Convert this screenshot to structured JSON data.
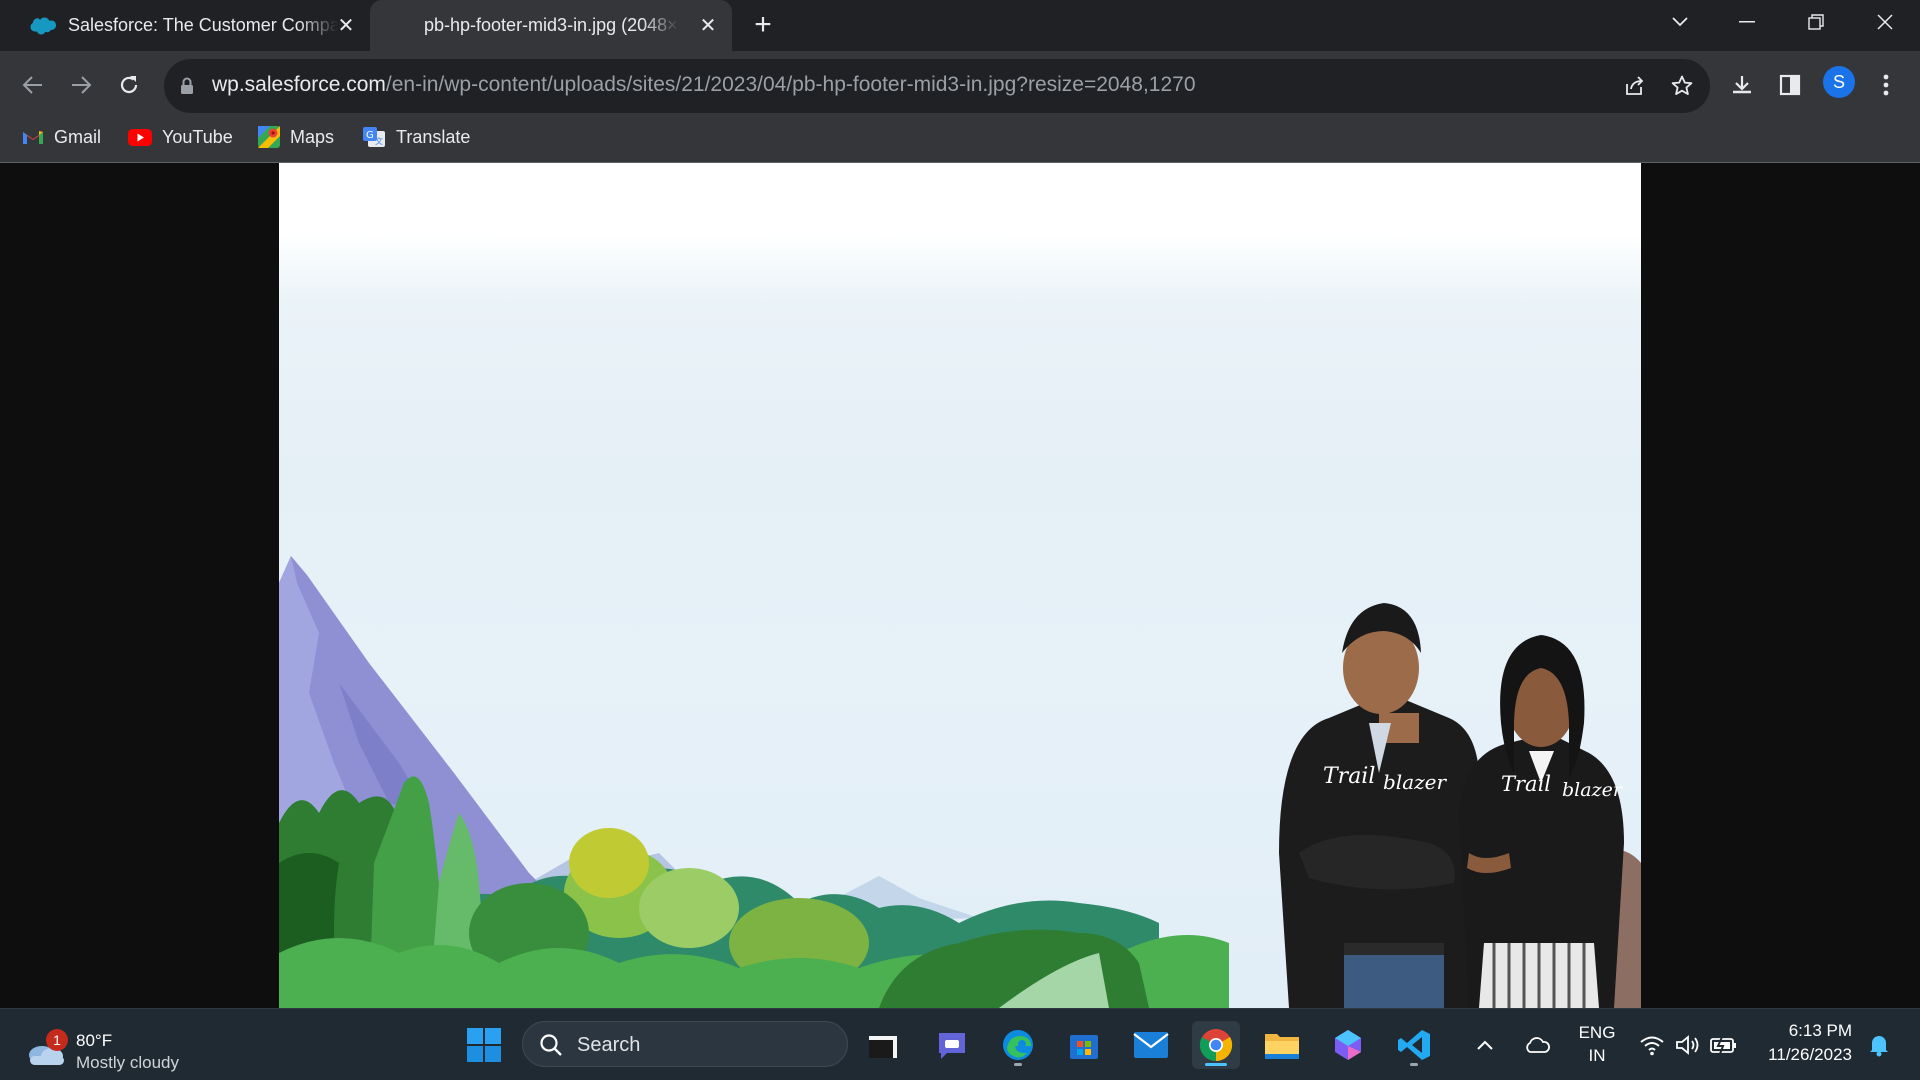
{
  "tabs": [
    {
      "title": "Salesforce: The Customer Company",
      "active": false
    },
    {
      "title": "pb-hp-footer-mid3-in.jpg (2048×1270)",
      "active": true
    }
  ],
  "address": {
    "host": "wp.salesforce.com",
    "path": "/en-in/wp-content/uploads/sites/21/2023/04/pb-hp-footer-mid3-in.jpg?resize=2048,1270"
  },
  "profile_initial": "S",
  "bookmarks": [
    {
      "label": "Gmail",
      "icon": "gmail-icon"
    },
    {
      "label": "YouTube",
      "icon": "youtube-icon"
    },
    {
      "label": "Maps",
      "icon": "maps-icon"
    },
    {
      "label": "Translate",
      "icon": "translate-icon"
    }
  ],
  "image_hoodie_text": [
    "Trail",
    "blazer"
  ],
  "taskbar": {
    "weather": {
      "temp": "80°F",
      "condition": "Mostly cloudy",
      "badge": "1"
    },
    "search_placeholder": "Search",
    "apps": [
      "file-explorer-dark",
      "teams",
      "edge",
      "store",
      "mail",
      "chrome",
      "file-explorer",
      "copilot",
      "vscode"
    ],
    "language": {
      "line1": "ENG",
      "line2": "IN"
    },
    "clock": {
      "time": "6:13 PM",
      "date": "11/26/2023"
    }
  },
  "colors": {
    "titlebar": "#202124",
    "toolbar": "#35363a",
    "accent": "#1a73e8",
    "taskbar": "#1f2a33"
  }
}
